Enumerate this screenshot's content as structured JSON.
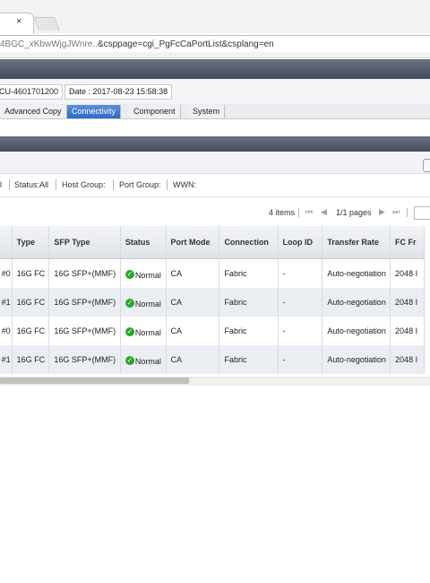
{
  "browser": {
    "tab_close": "×",
    "url_prefix": "4BGC_xKbwWjgJWnre..",
    "url_rest": "&csppage=cgi_PgFcCaPortList&csplang=en"
  },
  "info": {
    "serial": "CU-4601701200",
    "date": "Date : 2017-08-23 15:58:38"
  },
  "menu": {
    "tabs": [
      {
        "label": "Advanced Copy"
      },
      {
        "label": "Connectivity"
      },
      {
        "label": "Component"
      },
      {
        "label": "System"
      }
    ],
    "active_tab": "Connectivity"
  },
  "filters": {
    "type_fragment": "l",
    "status": "Status:All",
    "host_group": "Host Group:",
    "port_group": "Port Group:",
    "wwn": "WWN:"
  },
  "pager": {
    "items": "4 items",
    "pages": "1/1 pages",
    "first_icon": "first-page-icon",
    "prev_icon": "prev-page-icon",
    "next_icon": "next-page-icon",
    "last_icon": "last-page-icon"
  },
  "table": {
    "columns": [
      "",
      "Type",
      "SFP Type",
      "Status",
      "Port Mode",
      "Connection",
      "Loop ID",
      "Transfer Rate",
      "FC Fr"
    ],
    "rows": [
      [
        "#0",
        "16G FC",
        "16G SFP+(MMF)",
        "Normal",
        "CA",
        "Fabric",
        "-",
        "Auto-negotiation",
        "2048 I"
      ],
      [
        "#1",
        "16G FC",
        "16G SFP+(MMF)",
        "Normal",
        "CA",
        "Fabric",
        "-",
        "Auto-negotiation",
        "2048 I"
      ],
      [
        "#0",
        "16G FC",
        "16G SFP+(MMF)",
        "Normal",
        "CA",
        "Fabric",
        "-",
        "Auto-negotiation",
        "2048 I"
      ],
      [
        "#1",
        "16G FC",
        "16G SFP+(MMF)",
        "Normal",
        "CA",
        "Fabric",
        "-",
        "Auto-negotiation",
        "2048 I"
      ]
    ],
    "status_icon": "check-circle-icon",
    "status_color": "#2ea32e"
  },
  "colors": {
    "header_bar": "#4f5766",
    "active_tab": "#3a76cc"
  }
}
